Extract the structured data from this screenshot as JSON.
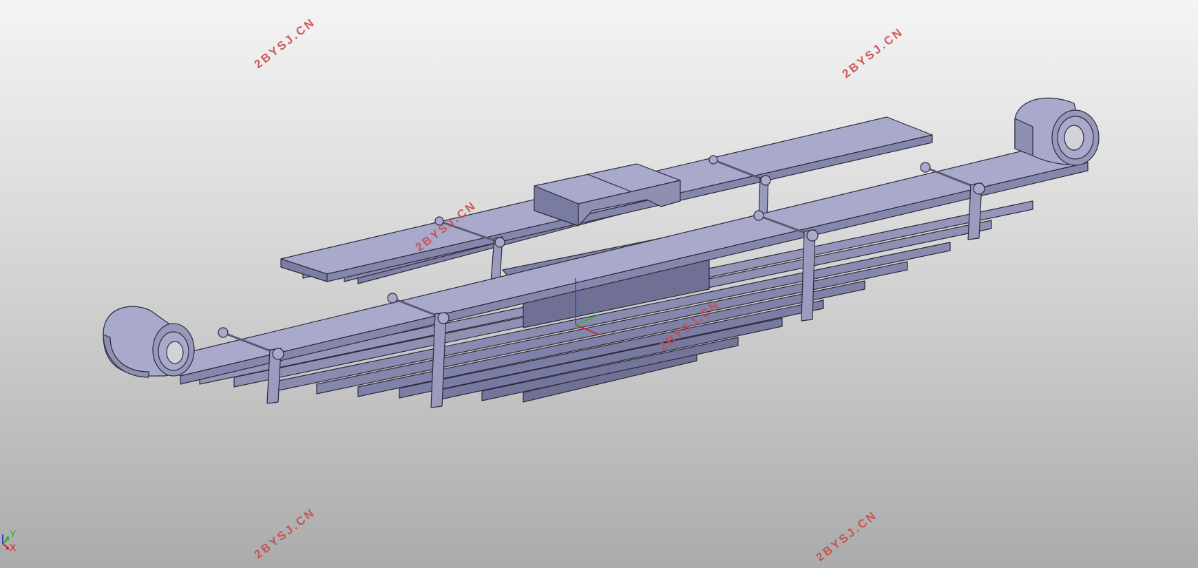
{
  "viewport": {
    "watermark_text": "2BYSJ.CN",
    "watermark_color": "#c94b4b"
  },
  "model": {
    "part_fill": "#a9a9cc",
    "part_shade": "#8f8fb4",
    "part_edge": "#2a2a38"
  },
  "triad": {
    "axis_x_label": "X",
    "axis_y_label": "Y",
    "x_color": "#d41f1f",
    "y_color": "#1fb31f",
    "z_color": "#3a3ad4"
  }
}
